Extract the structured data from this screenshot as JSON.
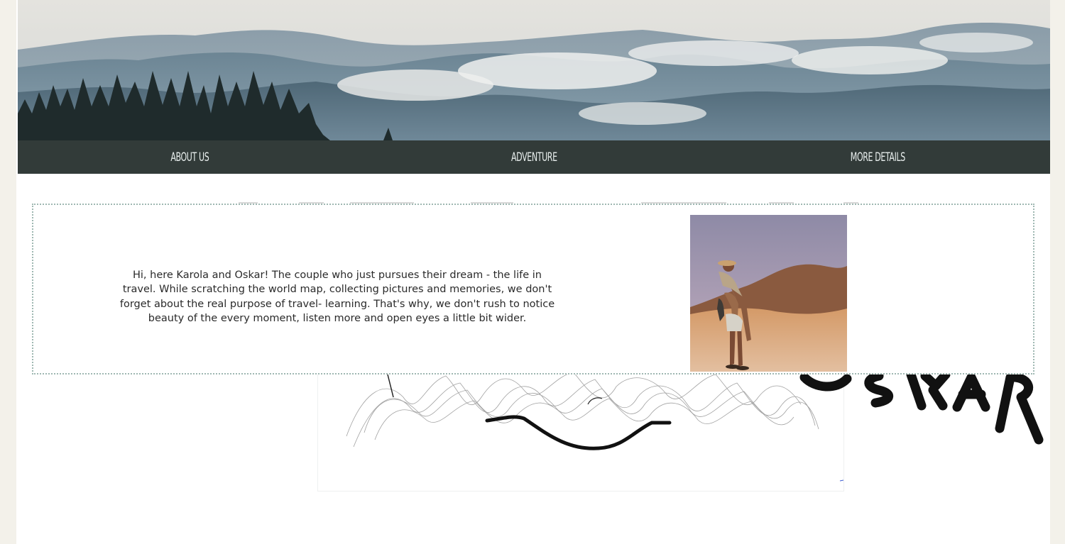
{
  "hero": {
    "image_icon": "mountain-forest-landscape"
  },
  "nav": {
    "items": [
      {
        "label": "About us"
      },
      {
        "label": "Adventure"
      },
      {
        "label": "More details"
      }
    ]
  },
  "about": {
    "text": "Hi, here Karola and Oskar! The couple who just pursues their dream - the life in travel. While scratching the world map, collecting pictures and memories, we don't forget about the real purpose of travel- learning. That's why, we don't rush to notice beauty of the every moment, listen more and open eyes a little bit wider.",
    "photo_icon": "desert-couple-photo"
  },
  "artwork": {
    "name_fragment": "OSKAR"
  },
  "colors": {
    "nav_bg": "#323b39",
    "nav_text": "#e9efee",
    "border": "#9fb8b2",
    "page_bg": "#f3f1ea"
  }
}
